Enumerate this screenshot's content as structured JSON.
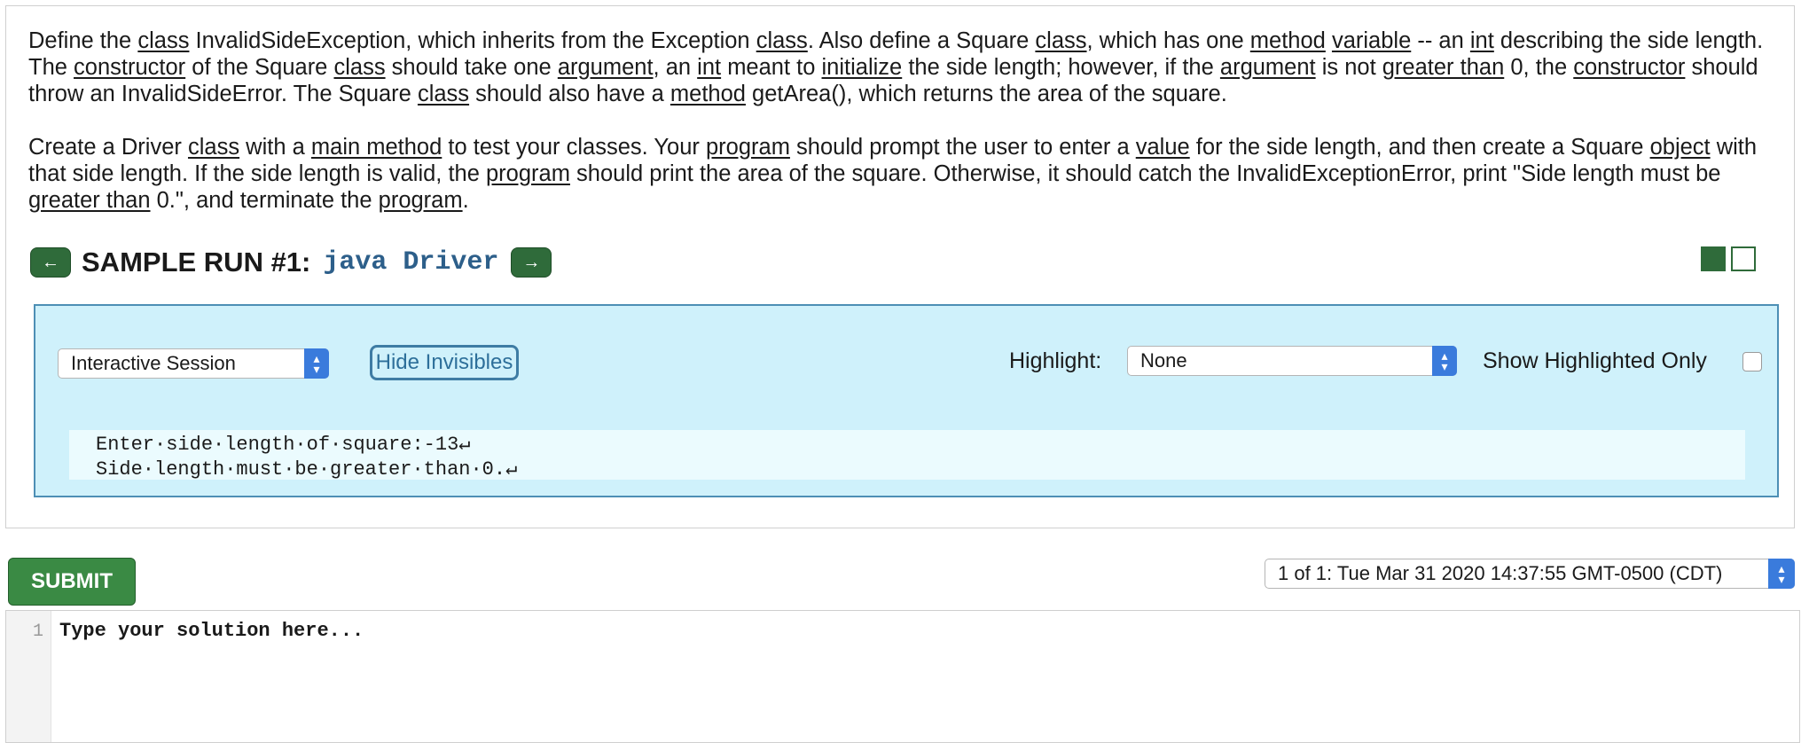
{
  "problem": {
    "p1": [
      {
        "t": "Define the ",
        "u": false
      },
      {
        "t": "class",
        "u": true
      },
      {
        "t": " InvalidSideException, which inherits from the Exception ",
        "u": false
      },
      {
        "t": "class",
        "u": true
      },
      {
        "t": ". Also define a Square ",
        "u": false
      },
      {
        "t": "class",
        "u": true
      },
      {
        "t": ", which has one ",
        "u": false
      },
      {
        "t": "method",
        "u": true
      },
      {
        "t": " ",
        "u": false
      },
      {
        "t": "variable",
        "u": true
      },
      {
        "t": " -- an ",
        "u": false
      },
      {
        "t": "int",
        "u": true
      },
      {
        "t": " describing the side length. The ",
        "u": false
      },
      {
        "t": "constructor",
        "u": true
      },
      {
        "t": " of the Square ",
        "u": false
      },
      {
        "t": "class",
        "u": true
      },
      {
        "t": " should take one ",
        "u": false
      },
      {
        "t": "argument",
        "u": true
      },
      {
        "t": ", an ",
        "u": false
      },
      {
        "t": "int",
        "u": true
      },
      {
        "t": " meant to ",
        "u": false
      },
      {
        "t": "initialize",
        "u": true
      },
      {
        "t": " the side length; however, if the ",
        "u": false
      },
      {
        "t": "argument",
        "u": true
      },
      {
        "t": " is not ",
        "u": false
      },
      {
        "t": "greater than",
        "u": true
      },
      {
        "t": " 0, the ",
        "u": false
      },
      {
        "t": "constructor",
        "u": true
      },
      {
        "t": " should throw an InvalidSideError. The Square ",
        "u": false
      },
      {
        "t": "class",
        "u": true
      },
      {
        "t": " should also have a ",
        "u": false
      },
      {
        "t": "method",
        "u": true
      },
      {
        "t": " getArea(), which returns the area of the square.",
        "u": false
      }
    ],
    "p2": [
      {
        "t": "Create a Driver ",
        "u": false
      },
      {
        "t": "class",
        "u": true
      },
      {
        "t": " with a ",
        "u": false
      },
      {
        "t": "main method",
        "u": true
      },
      {
        "t": " to test your classes. Your ",
        "u": false
      },
      {
        "t": "program",
        "u": true
      },
      {
        "t": " should prompt the user to enter a ",
        "u": false
      },
      {
        "t": "value",
        "u": true
      },
      {
        "t": " for the side length, and then create a Square ",
        "u": false
      },
      {
        "t": "object",
        "u": true
      },
      {
        "t": " with that side length. If the side length is valid, the ",
        "u": false
      },
      {
        "t": "program",
        "u": true
      },
      {
        "t": " should print the area of the square. Otherwise, it should catch the InvalidExceptionError, print \"Side length must be ",
        "u": false
      },
      {
        "t": "greater than",
        "u": true
      },
      {
        "t": " 0.\", and terminate the ",
        "u": false
      },
      {
        "t": "program",
        "u": true
      },
      {
        "t": ".",
        "u": false
      }
    ]
  },
  "sample": {
    "prev_label": "←",
    "next_label": "→",
    "title": "SAMPLE RUN #1:",
    "command": "java Driver"
  },
  "session": {
    "mode_value": "Interactive Session",
    "hide_label": "Hide Invisibles",
    "highlight_label": "Highlight:",
    "highlight_value": "None",
    "show_only_label": "Show Highlighted Only",
    "output_lines": [
      "Enter·side·length·of·square:-13↵",
      "Side·length·must·be·greater·than·0.↵"
    ]
  },
  "actions": {
    "submit_label": "SUBMIT",
    "version_value": "1 of 1: Tue Mar 31 2020 14:37:55 GMT-0500 (CDT)"
  },
  "editor": {
    "line_number": "1",
    "placeholder": "Type your solution here..."
  },
  "colors": {
    "accent_green": "#2f6b3a",
    "session_bg": "#cff1fb",
    "select_blue": "#3a7bdc"
  }
}
